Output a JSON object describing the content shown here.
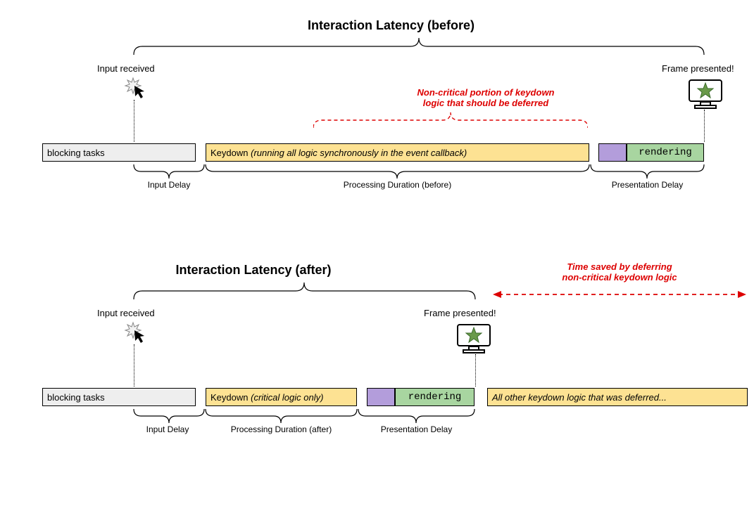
{
  "before": {
    "title": "Interaction Latency (before)",
    "input_received": "Input received",
    "frame_presented": "Frame presented!",
    "noncritical_note_l1": "Non-critical portion of keydown",
    "noncritical_note_l2": "logic that should be deferred",
    "blocking": "blocking tasks",
    "keydown_label": "Keydown",
    "keydown_detail": "(running all logic synchronously in the event callback)",
    "rendering": "rendering",
    "input_delay": "Input Delay",
    "processing": "Processing Duration (before)",
    "presentation": "Presentation Delay"
  },
  "after": {
    "title": "Interaction Latency (after)",
    "input_received": "Input received",
    "frame_presented": "Frame presented!",
    "timesaved_l1": "Time saved by deferring",
    "timesaved_l2": "non-critical keydown logic",
    "blocking": "blocking tasks",
    "keydown_label": "Keydown",
    "keydown_detail": "(critical logic only)",
    "rendering": "rendering",
    "deferred": "All other keydown logic that was deferred...",
    "input_delay": "Input Delay",
    "processing": "Processing Duration (after)",
    "presentation": "Presentation Delay"
  }
}
